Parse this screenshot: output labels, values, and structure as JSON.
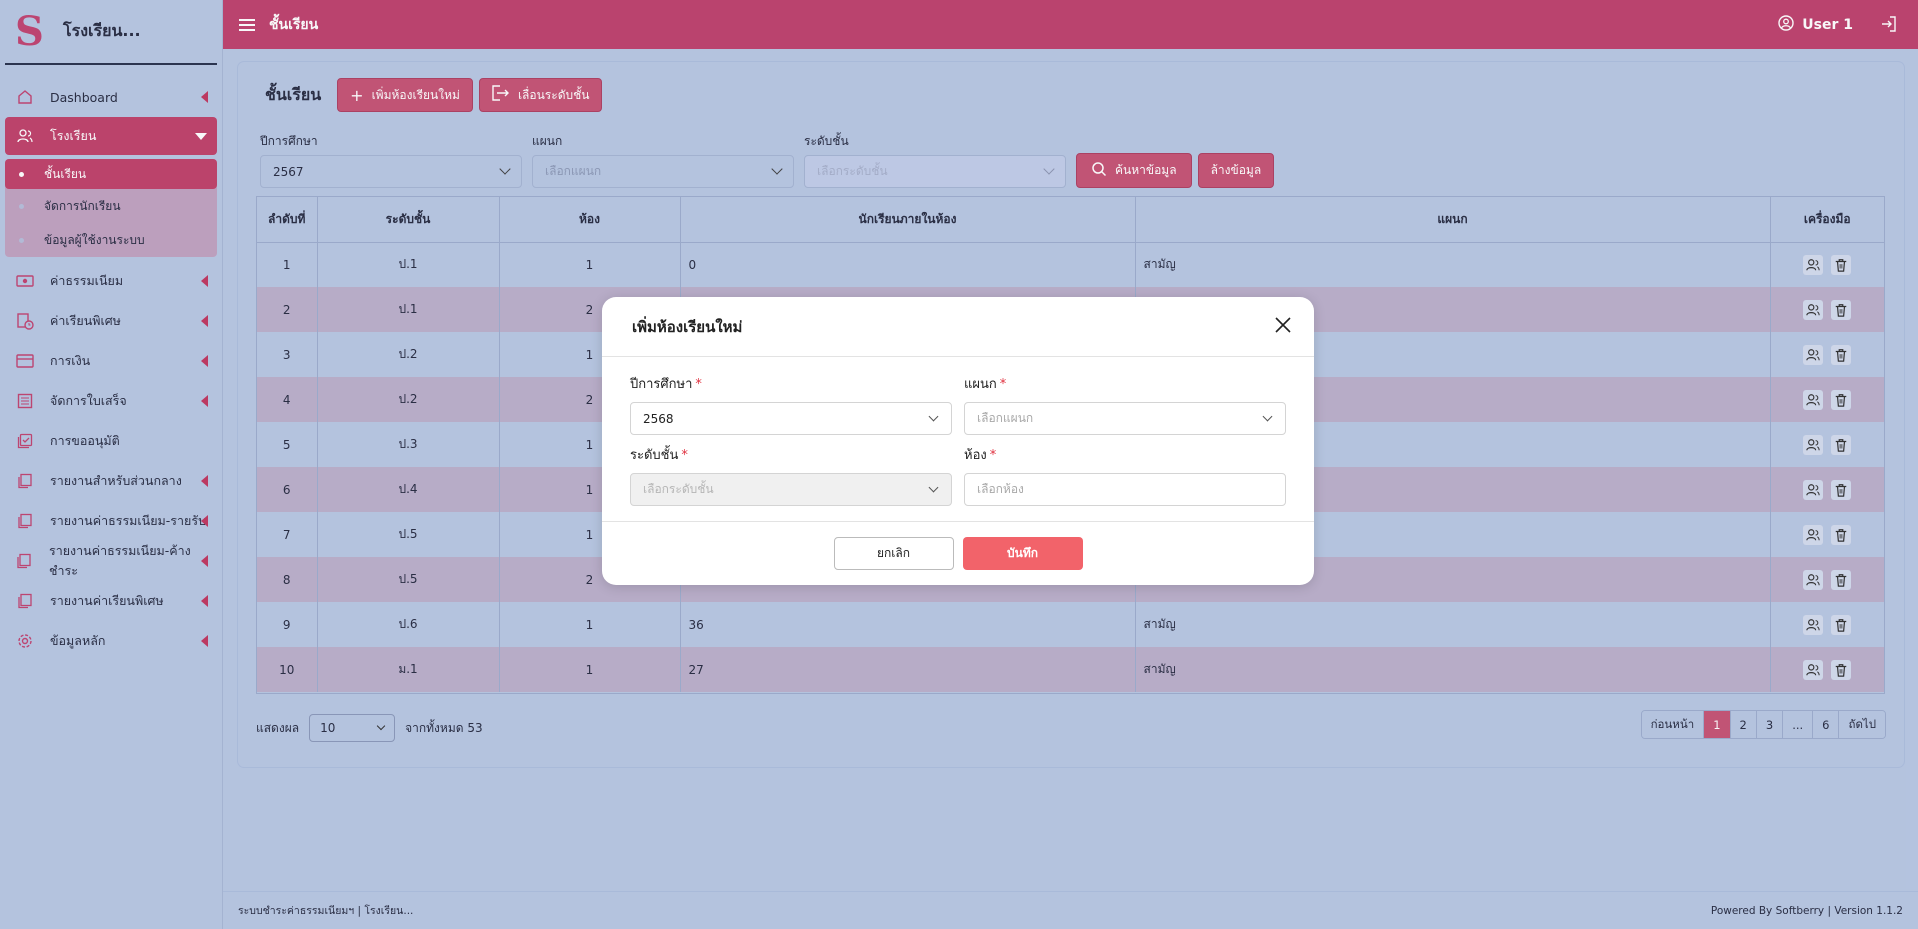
{
  "brand": {
    "logo": "S",
    "name": "โรงเรียน..."
  },
  "sidebar": {
    "items": [
      {
        "label": "Dashboard",
        "icon": "home-icon"
      },
      {
        "label": "โรงเรียน",
        "icon": "users-icon"
      },
      {
        "label": "ค่าธรรมเนียม",
        "icon": "banknote-icon"
      },
      {
        "label": "ค่าเรียนพิเศษ",
        "icon": "bill-clock-icon"
      },
      {
        "label": "การเงิน",
        "icon": "wallet-icon"
      },
      {
        "label": "จัดการใบเสร็จ",
        "icon": "receipt-icon"
      },
      {
        "label": "การขออนุมัติ",
        "icon": "approve-icon"
      },
      {
        "label": "รายงานสำหรับส่วนกลาง",
        "icon": "report-icon"
      },
      {
        "label": "รายงานค่าธรรมเนียม-รายรับ",
        "icon": "report-icon"
      },
      {
        "label": "รายงานค่าธรรมเนียม-ค้างชำระ",
        "icon": "report-icon"
      },
      {
        "label": "รายงานค่าเรียนพิเศษ",
        "icon": "report-icon"
      },
      {
        "label": "ข้อมูลหลัก",
        "icon": "gear-icon"
      }
    ],
    "subitems": [
      {
        "label": "ชั้นเรียน"
      },
      {
        "label": "จัดการนักเรียน"
      },
      {
        "label": "ข้อมูลผู้ใช้งานระบบ"
      }
    ]
  },
  "header": {
    "page_name": "ชั้นเรียน",
    "user": "User 1"
  },
  "main": {
    "title": "ชั้นเรียน",
    "add_button": "เพิ่มห้องเรียนใหม่",
    "promote_button": "เลื่อนระดับชั้น",
    "filters": {
      "year_label": "ปีการศึกษา",
      "year_value": "2567",
      "dept_label": "แผนก",
      "dept_placeholder": "เลือกแผนก",
      "level_label": "ระดับชั้น",
      "level_placeholder": "เลือกระดับชั้น",
      "search_button": "ค้นหาข้อมูล",
      "clear_button": "ล้างข้อมูล"
    },
    "table": {
      "headers": [
        "ลำดับที่",
        "ระดับชั้น",
        "ห้อง",
        "นักเรียนภายในห้อง",
        "แผนก",
        "เครื่องมือ"
      ],
      "rows": [
        [
          "1",
          "ป.1",
          "1",
          "0",
          "สามัญ"
        ],
        [
          "2",
          "ป.1",
          "2",
          "",
          ""
        ],
        [
          "3",
          "ป.2",
          "1",
          "",
          ""
        ],
        [
          "4",
          "ป.2",
          "2",
          "",
          ""
        ],
        [
          "5",
          "ป.3",
          "1",
          "",
          ""
        ],
        [
          "6",
          "ป.4",
          "1",
          "",
          ""
        ],
        [
          "7",
          "ป.5",
          "1",
          "",
          ""
        ],
        [
          "8",
          "ป.5",
          "2",
          "",
          ""
        ],
        [
          "9",
          "ป.6",
          "1",
          "36",
          "สามัญ"
        ],
        [
          "10",
          "ม.1",
          "1",
          "27",
          "สามัญ"
        ]
      ]
    },
    "show_label": "แสดงผล",
    "page_size": "10",
    "total_label": "จากทั้งหมด 53",
    "pager": [
      "ก่อนหน้า",
      "1",
      "2",
      "3",
      "...",
      "6",
      "ถัดไป"
    ]
  },
  "footer": {
    "left": "ระบบชำระค่าธรรมเนียมฯ | โรงเรียน...",
    "right": "Powered By Softberry | Version 1.1.2"
  },
  "modal": {
    "title": "เพิ่มห้องเรียนใหม่",
    "year_label": "ปีการศึกษา",
    "year_value": "2568",
    "dept_label": "แผนก",
    "dept_placeholder": "เลือกแผนก",
    "level_label": "ระดับชั้น",
    "level_placeholder": "เลือกระดับชั้น",
    "room_label": "ห้อง",
    "room_placeholder": "เลือกห้อง",
    "required_mark": "*",
    "cancel": "ยกเลิก",
    "save": "บันทึก"
  },
  "colors": {
    "accent": "#bf4570",
    "save": "#f2636a",
    "bg": "#b9c9e4"
  }
}
